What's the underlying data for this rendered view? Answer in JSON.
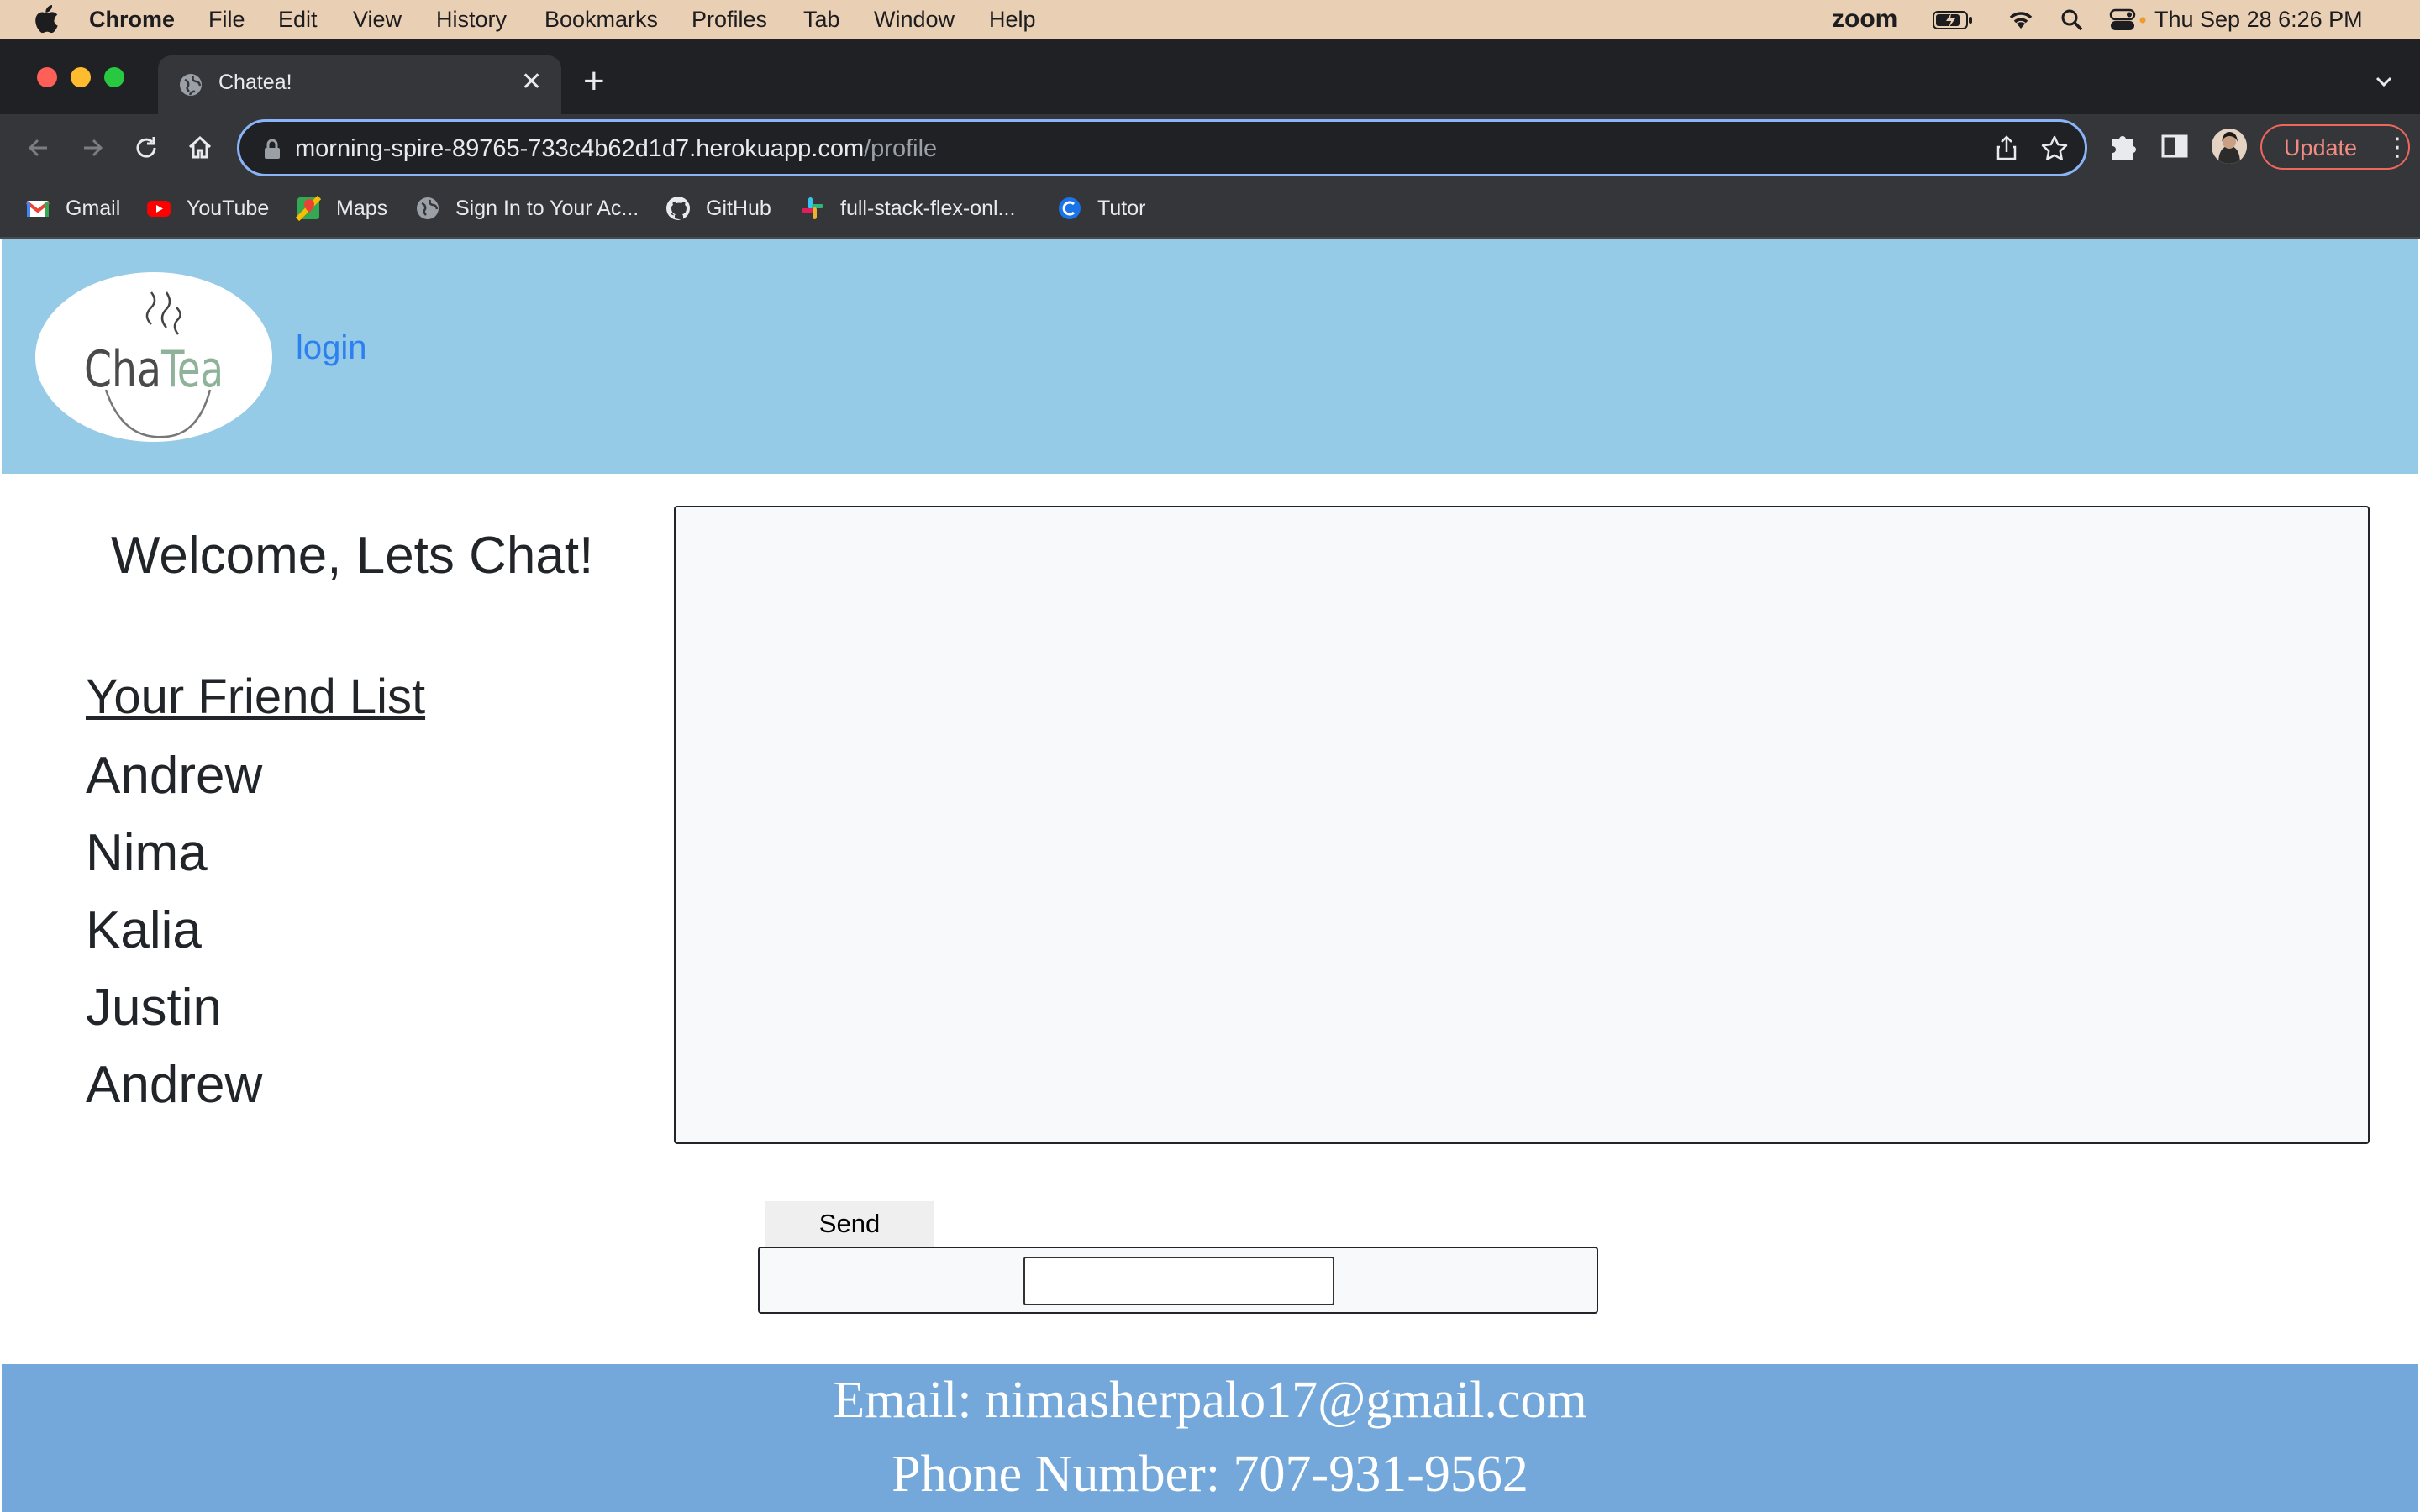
{
  "menubar": {
    "app": "Chrome",
    "items": [
      "File",
      "Edit",
      "View",
      "History",
      "Bookmarks",
      "Profiles",
      "Tab",
      "Window",
      "Help"
    ],
    "zoom": "zoom",
    "datetime": "Thu Sep 28  6:26 PM"
  },
  "browser": {
    "tab_title": "Chatea!",
    "url_host": "morning-spire-89765-733c4b62d1d7.herokuapp.com",
    "url_path": "/profile",
    "update_label": "Update",
    "bookmarks": [
      "Gmail",
      "YouTube",
      "Maps",
      "Sign In to Your Ac...",
      "GitHub",
      "full-stack-flex-onl...",
      "Tutor"
    ]
  },
  "header": {
    "logo_text": "ChaTea",
    "logo_text_a": "Cha",
    "logo_text_b": "Tea",
    "login_label": "login"
  },
  "sidebar": {
    "welcome": "Welcome, Lets Chat!",
    "friend_list_title": "Your Friend List",
    "friends": [
      "Andrew",
      "Nima",
      "Kalia",
      "Justin",
      "Andrew"
    ]
  },
  "chat": {
    "send_label": "Send",
    "message_value": ""
  },
  "footer": {
    "email": "Email: nimasherpalo17@gmail.com",
    "phone": "Phone Number: 707-931-9562"
  },
  "colors": {
    "header_bg": "#96cbe8",
    "footer_bg": "#74a8da",
    "link": "#2d80f0"
  }
}
